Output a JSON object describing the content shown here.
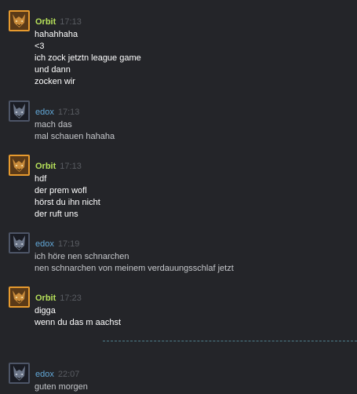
{
  "theme": {
    "background": "#242529",
    "orbit_name_color": "#b6e05a",
    "edox_name_color": "#62a8d8",
    "divider_color": "#4f7f8c"
  },
  "messages": [
    {
      "author": "Orbit",
      "time": "17:13",
      "avatar_icon": "orbit-avatar-icon",
      "lines": [
        "hahahhaha",
        "<3",
        "ich zock jetztn league game",
        "und dann",
        "zocken wir"
      ]
    },
    {
      "author": "edox",
      "time": "17:13",
      "avatar_icon": "edox-avatar-icon",
      "lines": [
        "mach das",
        "mal schauen hahaha"
      ]
    },
    {
      "author": "Orbit",
      "time": "17:13",
      "avatar_icon": "orbit-avatar-icon",
      "lines": [
        "hdf",
        "der prem wofl",
        "hörst du ihn nicht",
        "der ruft uns"
      ]
    },
    {
      "author": "edox",
      "time": "17:19",
      "avatar_icon": "edox-avatar-icon",
      "lines": [
        "ich höre nen schnarchen",
        "nen schnarchen von meinem verdauungsschlaf jetzt"
      ]
    },
    {
      "author": "Orbit",
      "time": "17:23",
      "avatar_icon": "orbit-avatar-icon",
      "lines": [
        "digga",
        "wenn du das m aachst"
      ]
    },
    {
      "author": "edox",
      "time": "22:07",
      "avatar_icon": "edox-avatar-icon",
      "lines": [
        "guten morgen"
      ]
    }
  ]
}
